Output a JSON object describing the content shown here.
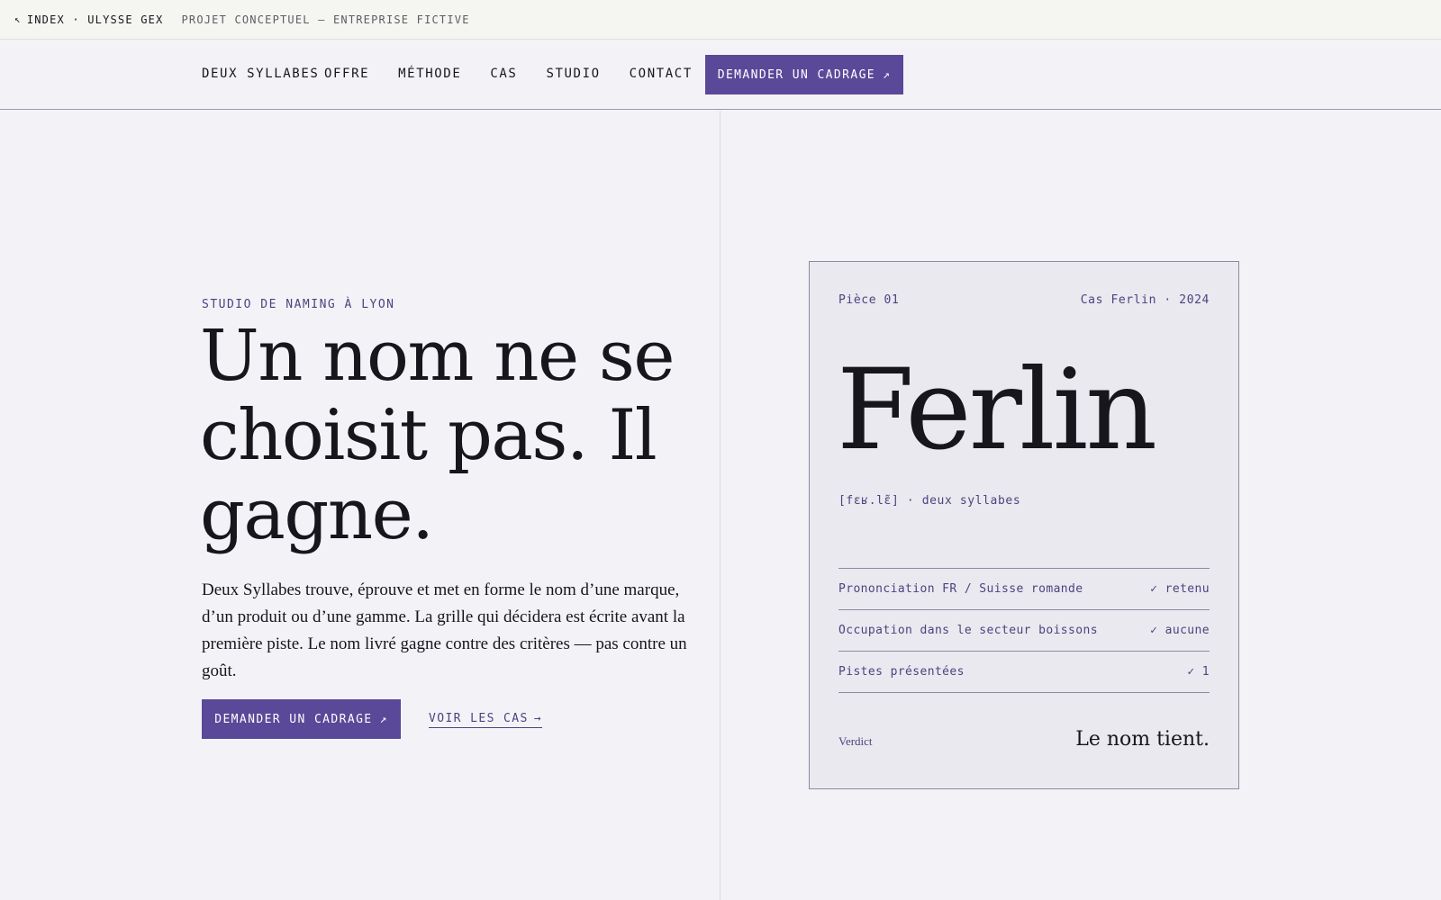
{
  "topbar": {
    "back_arrow": "↖",
    "back_label": "INDEX · ULYSSE GEX",
    "note": "PROJET CONCEPTUEL — ENTREPRISE FICTIVE"
  },
  "nav": {
    "brand": "DEUX SYLLABES",
    "links": [
      "OFFRE",
      "MÉTHODE",
      "CAS",
      "STUDIO",
      "CONTACT"
    ],
    "cta_label": "DEMANDER UN CADRAGE",
    "cta_arrow": "↗"
  },
  "hero": {
    "eyebrow": "STUDIO DE NAMING À LYON",
    "headline": "Un nom ne se choisit pas. Il gagne.",
    "lede": "Deux Syllabes trouve, éprouve et met en forme le nom d’une marque, d’un produit ou d’une gamme. La grille qui décidera est écrite avant la première piste. Le nom livré gagne contre des critères — pas contre un goût.",
    "primary_label": "DEMANDER UN CADRAGE",
    "primary_arrow": "↗",
    "secondary_label": "VOIR LES CAS",
    "secondary_arrow": "→"
  },
  "card": {
    "piece": "Pièce 01",
    "case": "Cas Ferlin · 2024",
    "name": "Ferlin",
    "phonetic": "[fɛʁ.lɛ̃] · deux syllabes",
    "checks": [
      {
        "label": "Prononciation FR / Suisse romande",
        "value": "✓ retenu"
      },
      {
        "label": "Occupation dans le secteur boissons",
        "value": "✓ aucune"
      },
      {
        "label": "Pistes présentées",
        "value": "✓ 1"
      }
    ],
    "verdict_label": "Verdict",
    "verdict_value": "Le nom tient."
  },
  "colors": {
    "accent": "#5a4898",
    "accent_text": "#4c4380",
    "background": "#f3f3f7",
    "card_background": "#eae9ef",
    "ink": "#17161d"
  }
}
